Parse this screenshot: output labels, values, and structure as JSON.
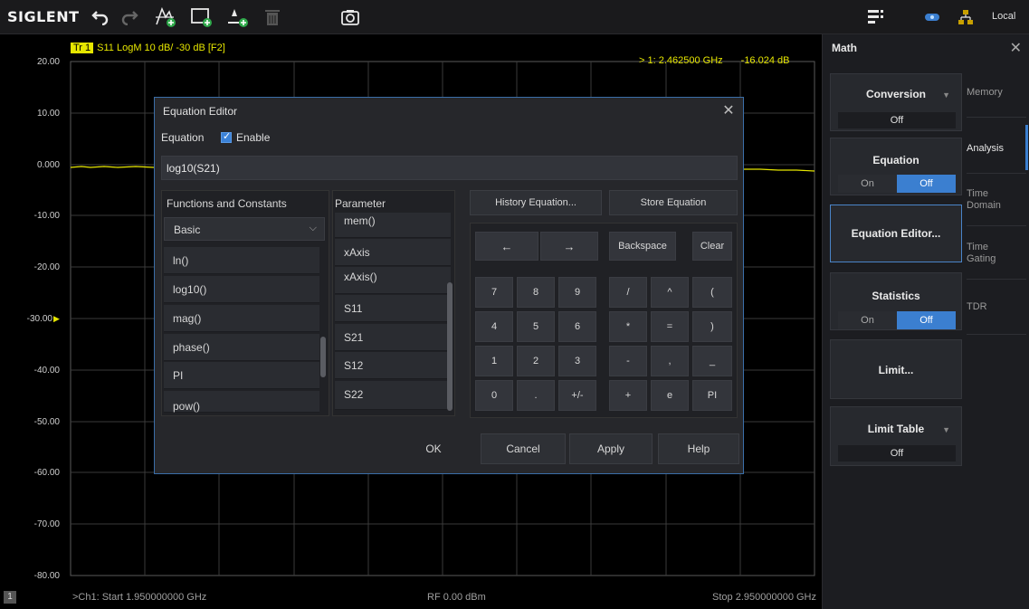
{
  "toolbar": {
    "logo": "SIGLENT",
    "status_label": "Local",
    "icons": [
      "undo-icon",
      "redo-icon",
      "add-trace-icon",
      "add-window-icon",
      "add-marker-icon",
      "delete-icon",
      "camera-icon",
      "touch-menu-icon",
      "usb-icon",
      "network-icon"
    ]
  },
  "plot": {
    "trace_tag": "Tr 1",
    "trace_info": "S11 LogM 10 dB/ -30 dB [F2]",
    "marker_label": "> 1:  2.462500 GHz",
    "marker_value": "-16.024 dB",
    "y_labels": [
      "20.00",
      "10.00",
      "0.000",
      "-10.00",
      "-20.00",
      "-30.00",
      "-40.00",
      "-50.00",
      "-60.00",
      "-70.00",
      "-80.00"
    ],
    "reference_marker": "▶",
    "channel_number": "1",
    "start_freq": ">Ch1: Start 1.950000000 GHz",
    "rf_power": "RF 0.00 dBm",
    "stop_freq": "Stop 2.950000000 GHz",
    "trace_color": "#e6e600"
  },
  "dialog": {
    "title": "Equation Editor",
    "close": "✕",
    "equation_label": "Equation",
    "enable_label": "Enable",
    "enable_checked": true,
    "equation_value": "log10(S21)",
    "functions_title": "Functions and Constants",
    "function_category": "Basic",
    "functions": [
      "ln()",
      "log10()",
      "mag()",
      "phase()",
      "PI",
      "pow()"
    ],
    "parameter_title": "Parameter",
    "parameters": [
      "mem()",
      "xAxis",
      "xAxis()",
      "S11",
      "S21",
      "S12",
      "S22"
    ],
    "history_button": "History Equation...",
    "store_button": "Store Equation",
    "keypad": {
      "left_arrow": "←",
      "right_arrow": "→",
      "backspace": "Backspace",
      "clear": "Clear",
      "rows": [
        [
          "7",
          "8",
          "9",
          "/",
          "^",
          "("
        ],
        [
          "4",
          "5",
          "6",
          "*",
          "=",
          ")"
        ],
        [
          "1",
          "2",
          "3",
          "-",
          ",",
          "_"
        ],
        [
          "0",
          ".",
          "+/-",
          "+",
          "e",
          "PI"
        ]
      ]
    },
    "ok": "OK",
    "cancel": "Cancel",
    "apply": "Apply",
    "help": "Help"
  },
  "side": {
    "title": "Math",
    "close": "✕",
    "conversion_label": "Conversion",
    "conversion_value": "Off",
    "equation_label": "Equation",
    "equation_on": "On",
    "equation_off": "Off",
    "equation_editor_label": "Equation Editor...",
    "statistics_label": "Statistics",
    "statistics_on": "On",
    "statistics_off": "Off",
    "limit_label": "Limit...",
    "limit_table_label": "Limit Table",
    "limit_table_value": "Off",
    "tabs": [
      "Memory",
      "Analysis",
      "Time Domain",
      "Time Gating",
      "TDR"
    ],
    "active_tab": "Analysis",
    "accent": "#3b7fd0"
  }
}
